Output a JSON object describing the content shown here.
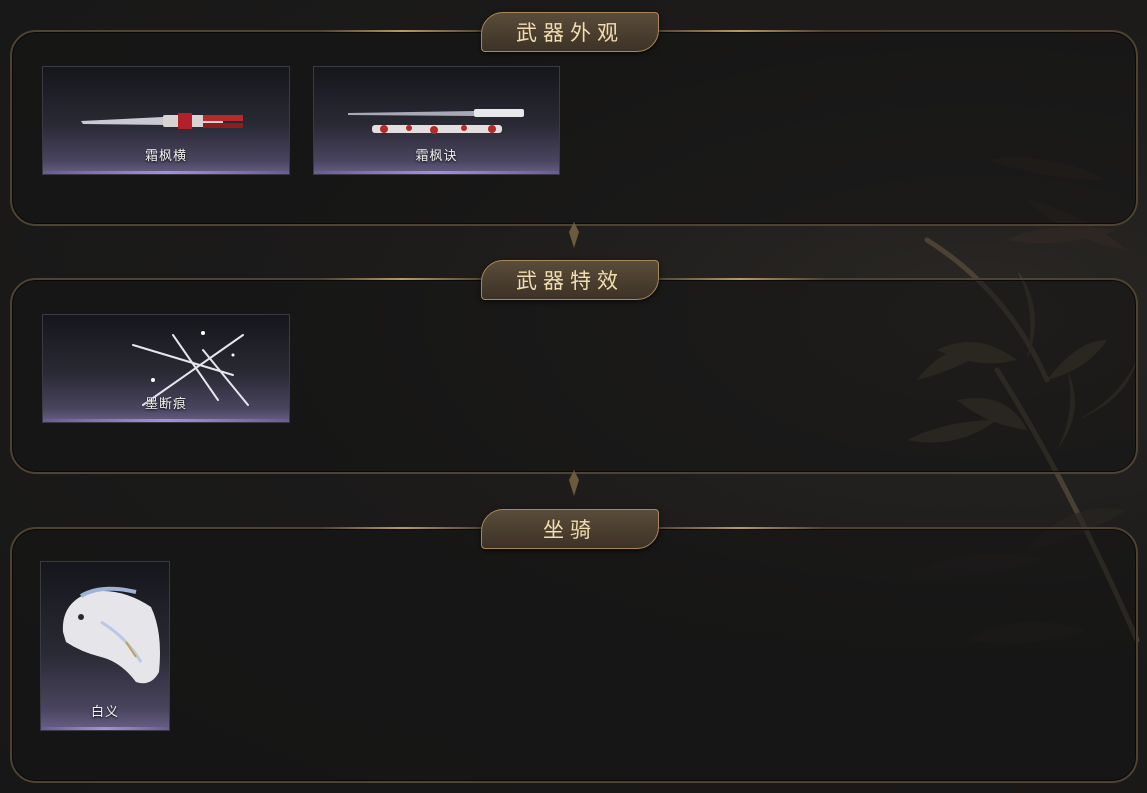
{
  "sections": [
    {
      "title": "武器外观",
      "items": [
        {
          "label": "霜枫横"
        },
        {
          "label": "霜枫诀"
        }
      ]
    },
    {
      "title": "武器特效",
      "items": [
        {
          "label": "墨断痕"
        }
      ]
    },
    {
      "title": "坐骑",
      "items": [
        {
          "label": "白义"
        }
      ]
    }
  ],
  "colors": {
    "gold": "#b89a62",
    "tab_text": "#f1ddb0",
    "card_accent": "#a592d6"
  }
}
